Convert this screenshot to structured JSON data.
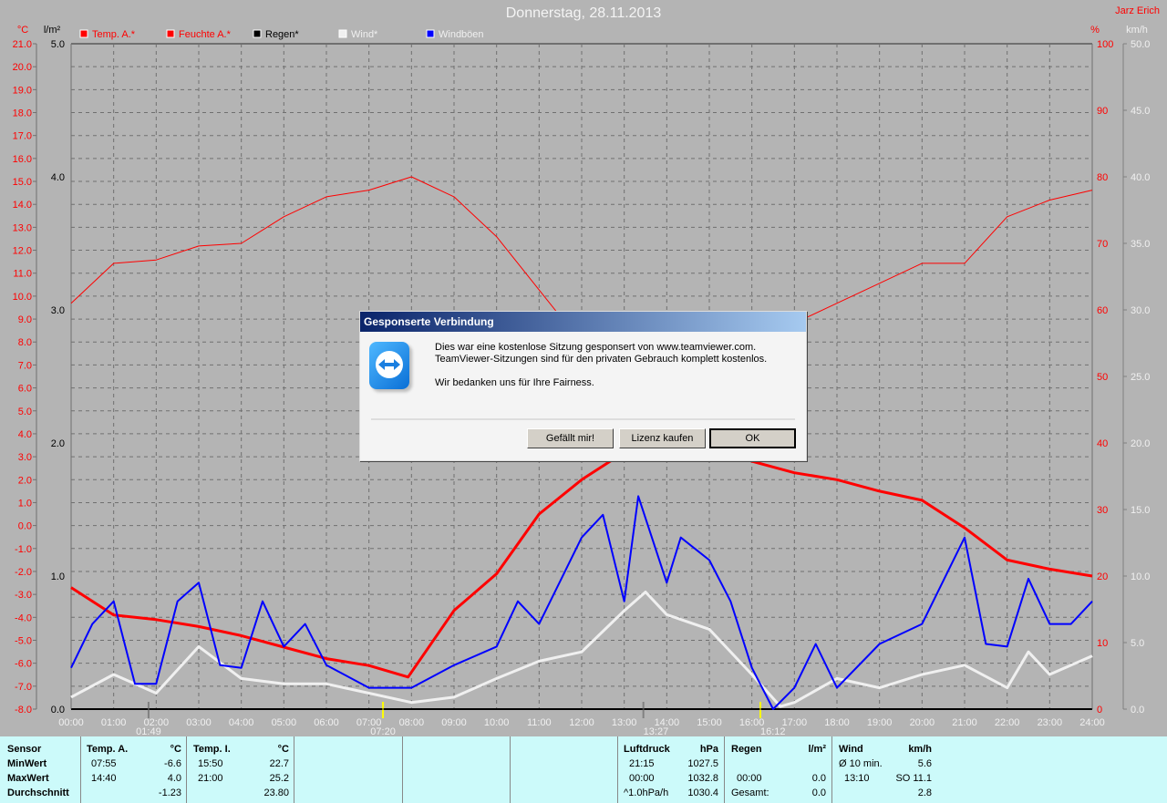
{
  "title": "Donnerstag, 28.11.2013",
  "author": "Jarz Erich",
  "chart_data": {
    "type": "line",
    "title": "Donnerstag, 28.11.2013",
    "axes": {
      "left_temp": {
        "unit": "°C",
        "range": [
          -8,
          21
        ],
        "step": 1,
        "color": "#ff0000"
      },
      "left_rain": {
        "unit": "l/m²",
        "range": [
          0,
          5
        ],
        "step": 1,
        "color": "#000000"
      },
      "right_humidity": {
        "unit": "%",
        "range": [
          0,
          100
        ],
        "step": 10,
        "color": "#ff0000"
      },
      "right_wind": {
        "unit": "km/h",
        "range": [
          0,
          50
        ],
        "step": 5,
        "color": "#f0f0f0"
      },
      "x": {
        "ticks": [
          "00:00",
          "01:00",
          "02:00",
          "03:00",
          "04:00",
          "05:00",
          "06:00",
          "07:00",
          "08:00",
          "09:00",
          "10:00",
          "11:00",
          "12:00",
          "13:00",
          "14:00",
          "15:00",
          "16:00",
          "17:00",
          "18:00",
          "19:00",
          "20:00",
          "21:00",
          "22:00",
          "23:00",
          "24:00"
        ]
      }
    },
    "grid": true,
    "legend": [
      {
        "name": "Temp. A.*",
        "color": "#ff0000"
      },
      {
        "name": "Feuchte A.*",
        "color": "#ff0000"
      },
      {
        "name": "Regen*",
        "color": "#000000"
      },
      {
        "name": "Wind*",
        "color": "#f0f0f0"
      },
      {
        "name": "Windböen",
        "color": "#0000ff"
      }
    ],
    "legend_placement": "top",
    "series": [
      {
        "name": "Temp. A.*",
        "axis": "left_temp",
        "color": "#ff0000",
        "x": [
          0,
          1,
          2,
          3,
          4,
          5,
          6,
          7,
          7.92,
          9,
          10,
          11,
          12,
          13,
          14,
          14.67,
          15,
          16,
          17,
          18,
          19,
          20,
          21,
          22,
          23,
          24
        ],
        "y": [
          -2.7,
          -3.9,
          -4.1,
          -4.4,
          -4.8,
          -5.3,
          -5.8,
          -6.1,
          -6.6,
          -3.7,
          -2.1,
          0.5,
          2.0,
          3.2,
          3.8,
          4.0,
          3.6,
          2.8,
          2.3,
          2.0,
          1.5,
          1.1,
          -0.1,
          -1.5,
          -1.9,
          -2.2
        ]
      },
      {
        "name": "Feuchte A.*",
        "axis": "right_humidity",
        "color": "#ff0000",
        "x": [
          0,
          1,
          2,
          3,
          4,
          5,
          6,
          7,
          8,
          9,
          10,
          11,
          12,
          13,
          14,
          15,
          16,
          17,
          18,
          19,
          20,
          21,
          22,
          23,
          24
        ],
        "y": [
          61,
          67,
          67.5,
          69.6,
          70,
          74,
          77,
          78,
          80,
          77,
          71,
          63,
          55,
          50,
          49,
          50,
          53,
          58,
          61,
          64,
          67,
          67,
          74,
          76.5,
          78
        ]
      },
      {
        "name": "Regen*",
        "axis": "left_rain",
        "color": "#000000",
        "x": [
          0,
          24
        ],
        "y": [
          0,
          0
        ]
      },
      {
        "name": "Wind*",
        "axis": "right_wind",
        "color": "#f0f0f0",
        "x": [
          0,
          1,
          2,
          3,
          4,
          5,
          6,
          7,
          8,
          9,
          10,
          11,
          12,
          13,
          13.5,
          14,
          15,
          16,
          16.67,
          17,
          18,
          19,
          20,
          21,
          22,
          22.5,
          23,
          24
        ],
        "y": [
          0.9,
          2.6,
          1.2,
          4.7,
          2.3,
          1.9,
          1.9,
          1.2,
          0.5,
          0.9,
          2.3,
          3.6,
          4.3,
          7.4,
          8.8,
          7.1,
          6.0,
          2.6,
          0.2,
          0.5,
          2.3,
          1.6,
          2.6,
          3.3,
          1.6,
          4.3,
          2.6,
          4.0
        ]
      },
      {
        "name": "Windböen",
        "axis": "right_wind",
        "color": "#0000ff",
        "x": [
          0,
          0.5,
          1,
          1.5,
          2,
          2.5,
          3,
          3.5,
          4,
          4.5,
          5,
          5.5,
          6,
          7,
          8,
          9,
          10,
          10.5,
          11,
          12,
          12.5,
          13,
          13.33,
          14,
          14.33,
          15,
          15.5,
          16,
          16.5,
          17,
          17.5,
          18,
          19,
          20,
          21,
          21.5,
          22,
          22.5,
          23,
          23.5,
          24
        ],
        "y": [
          3.1,
          6.4,
          8.1,
          1.9,
          1.9,
          8.1,
          9.5,
          3.3,
          3.1,
          8.1,
          4.7,
          6.4,
          3.3,
          1.6,
          1.6,
          3.3,
          4.7,
          8.1,
          6.4,
          12.9,
          14.6,
          8.1,
          16.0,
          9.5,
          12.9,
          11.2,
          8.1,
          3.1,
          0,
          1.6,
          4.9,
          1.6,
          4.9,
          6.4,
          12.9,
          4.9,
          4.7,
          9.8,
          6.4,
          6.4,
          8.1
        ]
      }
    ],
    "markers": [
      {
        "label": "01:49",
        "hour": 1.82,
        "color": "#808080",
        "icon": "moonrise-icon"
      },
      {
        "label": "07:20",
        "hour": 7.33,
        "color": "#ffff00",
        "icon": "sunrise-icon"
      },
      {
        "label": "13:27",
        "hour": 13.45,
        "color": "#808080",
        "icon": "moonset-icon"
      },
      {
        "label": "16:12",
        "hour": 16.2,
        "color": "#ffff00",
        "icon": "sunset-icon"
      }
    ]
  },
  "stats": {
    "sensor": {
      "header": "Sensor",
      "rows": [
        "MinWert",
        "MaxWert",
        "Durchschnitt"
      ]
    },
    "temp_a": {
      "header": "Temp. A.",
      "unit": "°C",
      "min_time": "07:55",
      "min": "-6.6",
      "max_time": "14:40",
      "max": "4.0",
      "avg": "-1.23"
    },
    "temp_i": {
      "header": "Temp. I.",
      "unit": "°C",
      "min_time": "15:50",
      "min": "22.7",
      "max_time": "21:00",
      "max": "25.2",
      "avg": "23.80"
    },
    "pressure": {
      "header": "Luftdruck",
      "unit": "hPa",
      "min_time": "21:15",
      "min": "1027.5",
      "max_time": "00:00",
      "max": "1032.8",
      "trend": "^1.0hPa/h",
      "avg": "1030.4"
    },
    "rain": {
      "header": "Regen",
      "unit": "l/m²",
      "max_time": "00:00",
      "max": "0.0",
      "total_label": "Gesamt:",
      "total": "0.0"
    },
    "wind": {
      "header": "Wind",
      "unit": "km/h",
      "avg_label": "Ø 10 min.",
      "avg10": "5.6",
      "max_time": "13:10",
      "max": "SO 11.1",
      "avg": "2.8"
    }
  },
  "dialog": {
    "title": "Gesponserte Verbindung",
    "line1": "Dies war eine kostenlose Sitzung gesponsert von www.teamviewer.com.",
    "line2": "TeamViewer-Sitzungen sind für den privaten Gebrauch komplett kostenlos.",
    "line3": "Wir bedanken uns für Ihre Fairness.",
    "btn_like": "Gefällt mir!",
    "btn_license": "Lizenz kaufen",
    "btn_ok": "OK"
  }
}
